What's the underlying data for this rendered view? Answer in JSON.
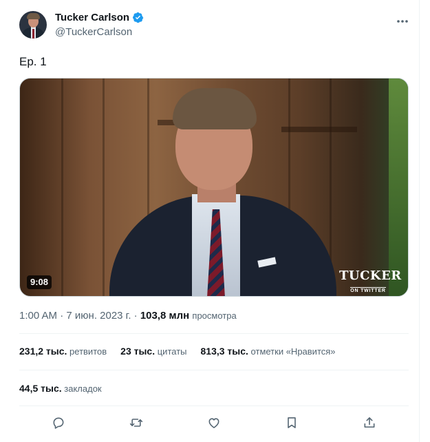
{
  "author": {
    "display_name": "Tucker Carlson",
    "handle": "@TuckerCarlson",
    "verified_icon": "verified-badge-icon",
    "avatar": "avatar-photo"
  },
  "more_icon": "more-horizontal-icon",
  "tweet": {
    "text": "Ep. 1"
  },
  "media": {
    "type": "video-thumbnail",
    "duration": "9:08",
    "watermark_main": "TUCKER",
    "watermark_sub": "ON TWITTER"
  },
  "meta": {
    "time": "1:00 AM",
    "separator": "·",
    "date": "7 июн. 2023 г.",
    "views_count": "103,8 млн",
    "views_label": "просмотра"
  },
  "stats": [
    {
      "count": "231,2 тыс.",
      "label": "ретвитов"
    },
    {
      "count": "23 тыс.",
      "label": "цитаты"
    },
    {
      "count": "813,3 тыс.",
      "label": "отметки «Нравится»"
    }
  ],
  "bookmarks": {
    "count": "44,5 тыс.",
    "label": "закладок"
  },
  "actions": [
    {
      "name": "reply-icon"
    },
    {
      "name": "retweet-icon"
    },
    {
      "name": "like-icon"
    },
    {
      "name": "bookmark-icon"
    },
    {
      "name": "share-icon"
    }
  ],
  "colors": {
    "text_primary": "#0f1419",
    "text_secondary": "#536471",
    "verified_blue": "#1d9bf0",
    "divider": "#eff3f4"
  }
}
